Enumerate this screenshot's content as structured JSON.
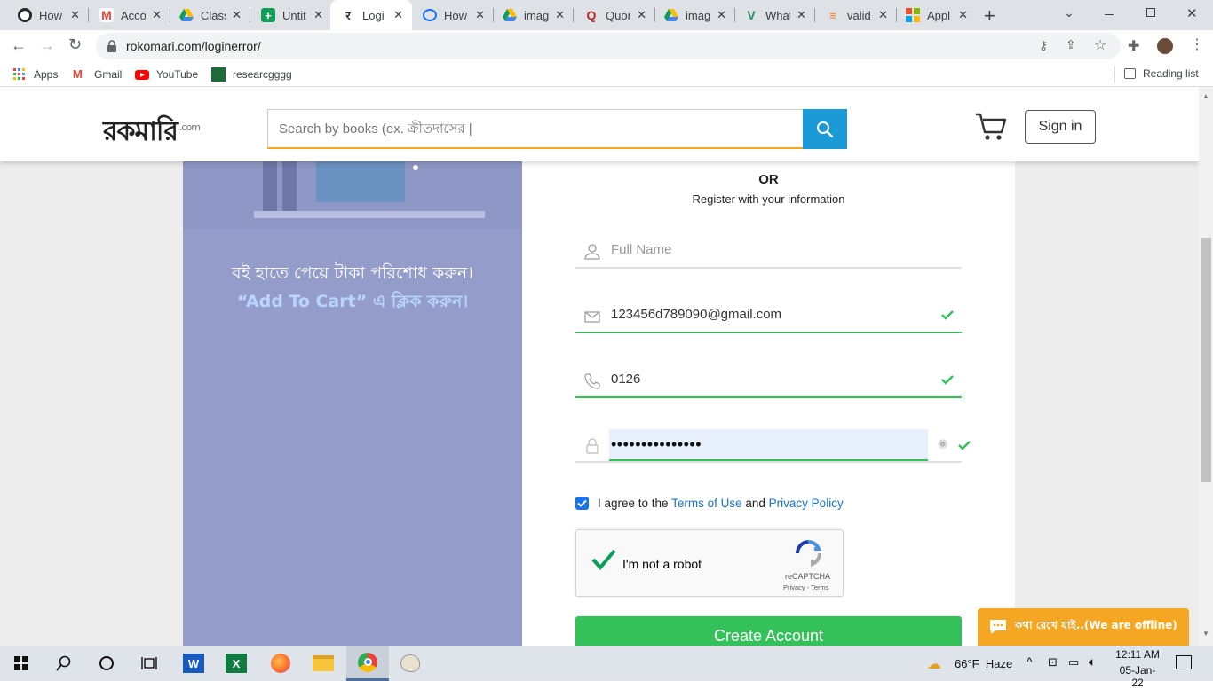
{
  "browser": {
    "tabs": [
      {
        "title": "How",
        "favicon": "github-icon",
        "color": "#24292e"
      },
      {
        "title": "Acco",
        "favicon": "gmail-icon",
        "color": "#ea4335"
      },
      {
        "title": "Class",
        "favicon": "google-drive-icon",
        "color": "#fbbc04"
      },
      {
        "title": "Untit",
        "favicon": "google-sheets-icon",
        "color": "#0f9d58"
      },
      {
        "title": "Logi",
        "favicon": "rokomari-icon",
        "color": "#f5a623",
        "active": true
      },
      {
        "title": "How",
        "favicon": "reddit-icon",
        "color": "#1a73e8"
      },
      {
        "title": "imag",
        "favicon": "google-drive-icon",
        "color": "#fbbc04"
      },
      {
        "title": "Quor",
        "favicon": "quora-icon",
        "color": "#b92b27"
      },
      {
        "title": "imag",
        "favicon": "google-drive-icon",
        "color": "#fbbc04"
      },
      {
        "title": "What",
        "favicon": "vectors-icon",
        "color": "#2d8a5f"
      },
      {
        "title": "valid",
        "favicon": "stackoverflow-icon",
        "color": "#f48024"
      },
      {
        "title": "Appl",
        "favicon": "microsoft-icon",
        "color": "#f25022"
      }
    ],
    "new_tab": "+",
    "url": "rokomari.com/loginerror/",
    "bookmarks": [
      {
        "label": "Apps",
        "icon": "apps-grid-icon"
      },
      {
        "label": "Gmail",
        "icon": "gmail-icon"
      },
      {
        "label": "YouTube",
        "icon": "youtube-icon"
      },
      {
        "label": "researcgggg",
        "icon": "researcggg-icon"
      }
    ],
    "reading_list": "Reading list"
  },
  "site": {
    "logo_text": "রকমারি",
    "logo_suffix": ".com",
    "search_placeholder": "Search by books (ex. ক্রীতদাসের |",
    "signin": "Sign in"
  },
  "left_panel": {
    "line1": "বই হাতে পেয়ে টাকা পরিশোধ করুন।",
    "line2": "“Add To Cart” এ ক্লিক করুন।"
  },
  "form": {
    "or_label": "OR",
    "subtitle": "Register with your information",
    "fullname_placeholder": "Full Name",
    "email": "123456d789090@gmail.com",
    "phone": "0126",
    "password_mask": "•••••••••••••••",
    "terms_prefix": "I agree to the",
    "terms_link": "Terms of Use",
    "terms_and": "and",
    "privacy_link": "Privacy Policy",
    "recaptcha_label": "I'm not a robot",
    "recaptcha_brand": "reCAPTCHA",
    "recaptcha_links": "Privacy - Terms",
    "create_button": "Create Account"
  },
  "chat_widget": {
    "label": "কথা রেখে যাই..(We are offline)"
  },
  "taskbar": {
    "weather": "66°F  Haze",
    "time": "12:11 AM",
    "date": "05-Jan-22"
  },
  "colors": {
    "accent_blue": "#1a9ad6",
    "success_green": "#34c15a",
    "chat_orange": "#f5a623",
    "panel_purple": "#949dc9",
    "link_blue": "#1a73c8"
  }
}
